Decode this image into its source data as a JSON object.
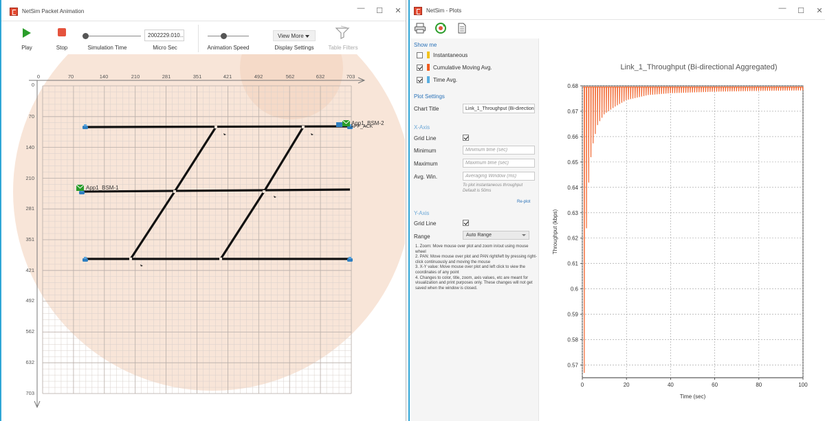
{
  "animation_window": {
    "title": "NetSim Packet Animation",
    "toolbar": {
      "play_label": "Play",
      "stop_label": "Stop",
      "simulation_time_label": "Simulation Time",
      "time_value": "2002229.010...",
      "time_unit_label": "Micro Sec",
      "animation_speed_label": "Animation Speed",
      "view_more_label": "View More",
      "display_settings_label": "Display Settings",
      "table_filters_label": "Table Filters"
    },
    "grid": {
      "x_ticks": [
        "0",
        "70",
        "140",
        "210",
        "281",
        "351",
        "421",
        "492",
        "562",
        "632",
        "703"
      ],
      "y_ticks": [
        "0",
        "70",
        "140",
        "210",
        "281",
        "351",
        "421",
        "492",
        "562",
        "632",
        "703"
      ]
    },
    "nodes": {
      "bsm1_label": "App1_BSM-1",
      "bsm2_label": "App1_BSM-2",
      "ack_label": "APP_ACK"
    }
  },
  "plots_window": {
    "title": "NetSim - Plots",
    "show_me": {
      "heading": "Show me",
      "instantaneous_label": "Instantaneous",
      "cumulative_label": "Cumulative Moving Avg.",
      "time_avg_label": "Time Avg.",
      "instantaneous_color": "#f2c21b",
      "cumulative_color": "#f05a1e",
      "time_avg_color": "#5aaee0"
    },
    "plot_settings": {
      "heading": "Plot Settings",
      "chart_title_label": "Chart Title",
      "chart_title_value": "Link_1_Throughput (Bi-directional Aggregated)"
    },
    "x_axis": {
      "heading": "X-Axis",
      "grid_line_label": "Grid Line",
      "minimum_label": "Minimum",
      "minimum_placeholder": "Minimum time (sec)",
      "maximum_label": "Maximum",
      "maximum_placeholder": "Maximum time (sec)",
      "avg_win_label": "Avg. Win.",
      "avg_win_placeholder": "Averaging Window (ms)",
      "hint_line1": "To plot instantaneous throughput",
      "hint_line2": "Default is 50ms",
      "replot_label": "Re-plot"
    },
    "y_axis": {
      "heading": "Y-Axis",
      "grid_line_label": "Grid Line",
      "range_label": "Range",
      "range_value": "Auto Range"
    },
    "notes": [
      "1. Zoom: Move mouse over plot and zoom in/out using mouse wheel",
      "2. PAN: Move mouse over plot and PAN right/left by pressing right-click continuously and moving the mouse",
      "3. X-Y value: Move mouse over plot and left click to view the coordinates of any point",
      "4. Changes to color, title, zoom, axis values, etc are meant for visualization and print purposes only. These changes will not get saved when the window is closed."
    ]
  },
  "chart_data": {
    "type": "line",
    "title": "Link_1_Throughput (Bi-directional Aggregated)",
    "xlabel": "Time (sec)",
    "ylabel": "Throughput (kbps)",
    "xlim": [
      0,
      100
    ],
    "ylim": [
      0.565,
      0.68
    ],
    "x_ticks": [
      0,
      20,
      40,
      60,
      80,
      100
    ],
    "y_ticks": [
      0.57,
      0.58,
      0.59,
      0.6,
      0.61,
      0.62,
      0.63,
      0.64,
      0.65,
      0.66,
      0.67,
      0.68
    ],
    "grid": true,
    "series": [
      {
        "name": "Cumulative Moving Avg.",
        "color": "#f05a1e",
        "pattern": "sawtooth",
        "upper_value": 0.6795,
        "lower_envelope": [
          [
            0.9,
            0.567
          ],
          [
            1.9,
            0.624
          ],
          [
            2.9,
            0.642
          ],
          [
            3.9,
            0.652
          ],
          [
            5,
            0.658
          ],
          [
            7,
            0.665
          ],
          [
            10,
            0.669
          ],
          [
            15,
            0.672
          ],
          [
            20,
            0.6745
          ],
          [
            30,
            0.6765
          ],
          [
            40,
            0.6772
          ],
          [
            60,
            0.6778
          ],
          [
            80,
            0.6781
          ],
          [
            100,
            0.6783
          ]
        ]
      }
    ]
  }
}
